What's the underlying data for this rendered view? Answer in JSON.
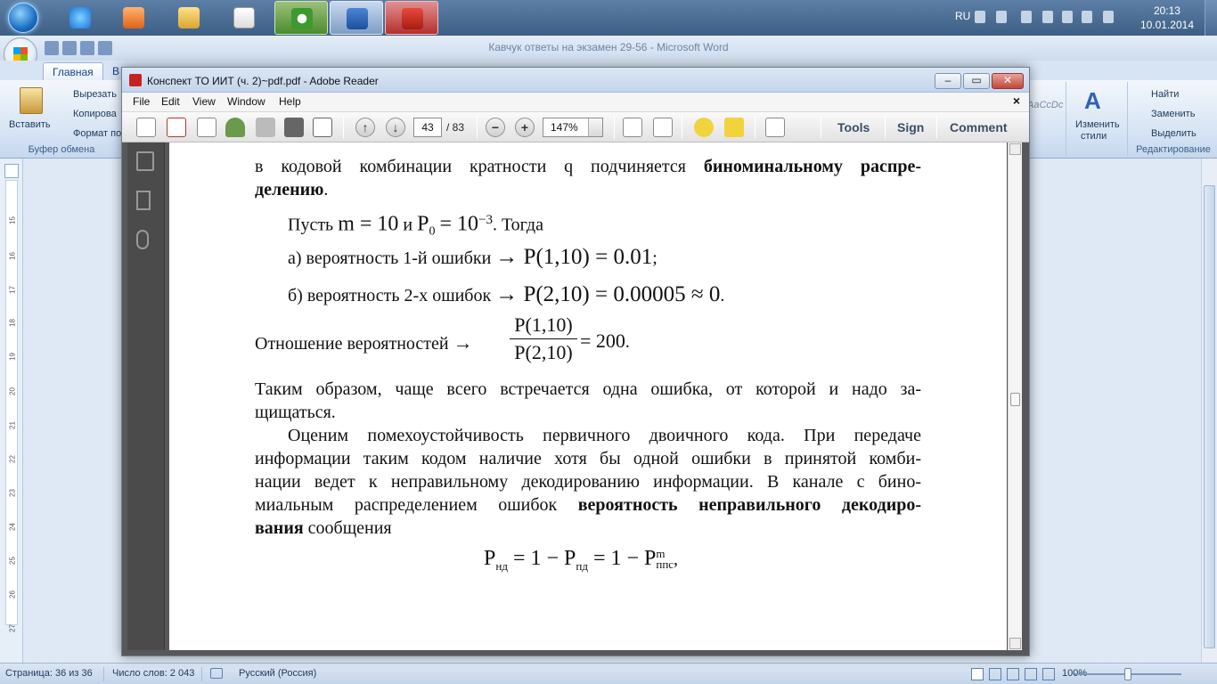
{
  "taskbar": {
    "apps": [
      "windows-start",
      "ie",
      "media",
      "explorer",
      "solitaire",
      "utorrent",
      "word",
      "adobe"
    ],
    "lang": "RU",
    "time": "20:13",
    "date": "10.01.2014"
  },
  "word": {
    "title": "Кавчук ответы на экзамен 29-56 - Microsoft Word",
    "tabs": [
      "Главная",
      "В"
    ],
    "ribbon": {
      "paste": "Вставить",
      "cut": "Вырезать",
      "copy": "Копирова",
      "format": "Формат по",
      "clipboard_group": "Буфер обмена",
      "change_styles": "Изменить",
      "styles": "стили",
      "find": "Найти",
      "replace": "Заменить",
      "select": "Выделить",
      "editing_group": "Редактирование",
      "style_preview": "AaCcDc"
    },
    "ruler_numbers": [
      "15",
      "16",
      "17",
      "18",
      "19",
      "20",
      "21",
      "22",
      "23",
      "24",
      "25",
      "26",
      "27"
    ],
    "status": {
      "page": "Страница: 36 из 36",
      "words": "Число слов: 2 043",
      "language": "Русский (Россия)",
      "zoom": "100%"
    }
  },
  "reader": {
    "title": "Конспект ТО ИИТ (ч. 2)~pdf.pdf - Adobe Reader",
    "menu": [
      "File",
      "Edit",
      "View",
      "Window",
      "Help"
    ],
    "page_current": "43",
    "page_total": "/ 83",
    "zoom": "147%",
    "tools": "Tools",
    "sign": "Sign",
    "comment": "Comment"
  },
  "document": {
    "line1_a": "в кодовой комбинации кратности q подчиняется",
    "line1_b": "биноминальному распре-",
    "line2_b": "делению",
    "line2_c": ".",
    "let_prefix": "Пусть",
    "let_m": "m = 10",
    "let_and": "и",
    "let_p": "P",
    "let_p_sub": "0",
    "let_eq": "= 10",
    "let_exp": "−3",
    "let_then": ". Тогда",
    "item_a_text": "а) вероятность 1-й ошибки",
    "item_a_formula": "→ P(1,10) = 0.01",
    "item_a_end": ";",
    "item_b_text": "б) вероятность 2-х ошибок",
    "item_b_formula": "→ P(2,10) = 0.00005 ≈ 0",
    "item_b_end": ".",
    "ratio_text": "Отношение вероятностей",
    "ratio_arrow": "→",
    "ratio_num": "P(1,10)",
    "ratio_den": "P(2,10)",
    "ratio_eq": "= 200",
    "ratio_end": ".",
    "para1_l1": "Таким образом, чаще всего встречается одна ошибка, от которой и надо за-",
    "para1_l2": "щищаться.",
    "para2_l1": "Оценим помехоустойчивость первичного двоичного кода. При передаче",
    "para2_l2": "информации таким кодом наличие хотя бы одной ошибки в принятой комби-",
    "para2_l3": "нации ведет к неправильному декодированию информации. В канале с бино-",
    "para2_l4a": "миальным распределением ошибок",
    "para2_l4b": "вероятность неправильного декодиро-",
    "para2_l5a": "вания",
    "para2_l5b": "сообщения",
    "final_formula": "P",
    "final_sub1": "нд",
    "final_mid": "= 1 − P",
    "final_sub2": "пд",
    "final_mid2": "= 1 − P",
    "final_sup": "m",
    "final_sub3": "ппс",
    "final_end": ","
  }
}
